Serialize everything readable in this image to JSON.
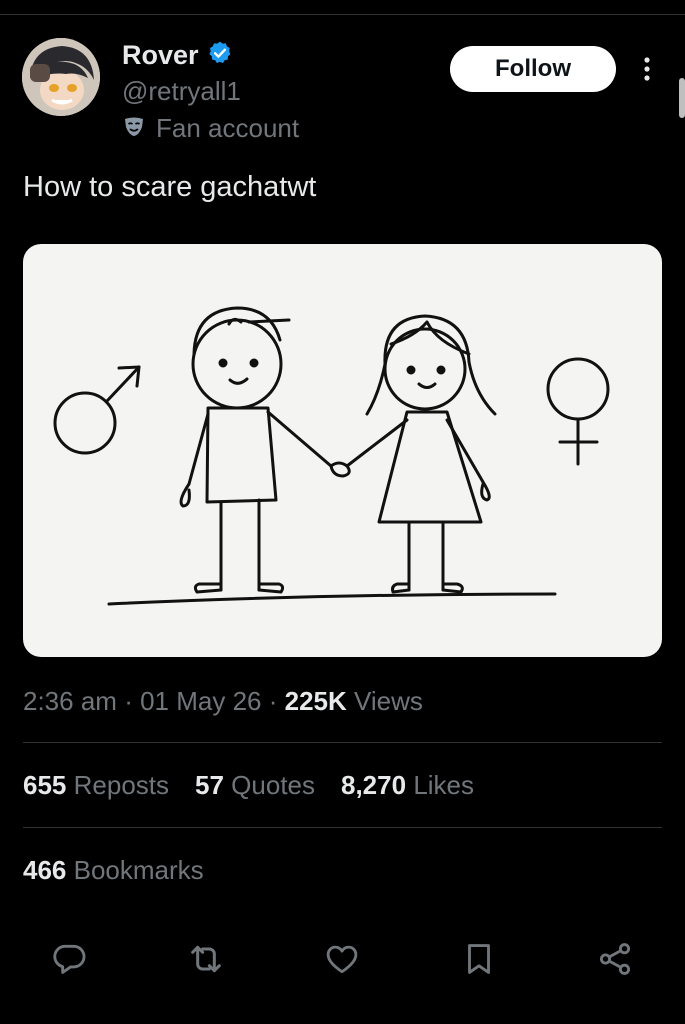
{
  "author": {
    "name": "Rover",
    "handle": "@retryall1",
    "affiliation_label": "Fan account",
    "verified_icon": "verified-badge-icon",
    "affiliation_icon": "mask-icon",
    "accent_color": "#1d9bf0"
  },
  "follow_button": {
    "label": "Follow"
  },
  "tweet": {
    "text": "How to scare gachatwt"
  },
  "meta": {
    "time": "2:36 am",
    "date": "01 May 26",
    "views_count": "225K",
    "views_label": "Views"
  },
  "stats": {
    "reposts_count": "655",
    "reposts_label": "Reposts",
    "quotes_count": "57",
    "quotes_label": "Quotes",
    "likes_count": "8,270",
    "likes_label": "Likes",
    "bookmarks_count": "466",
    "bookmarks_label": "Bookmarks"
  },
  "actions": [
    "reply-icon",
    "repost-icon",
    "like-icon",
    "bookmark-icon",
    "share-icon"
  ]
}
